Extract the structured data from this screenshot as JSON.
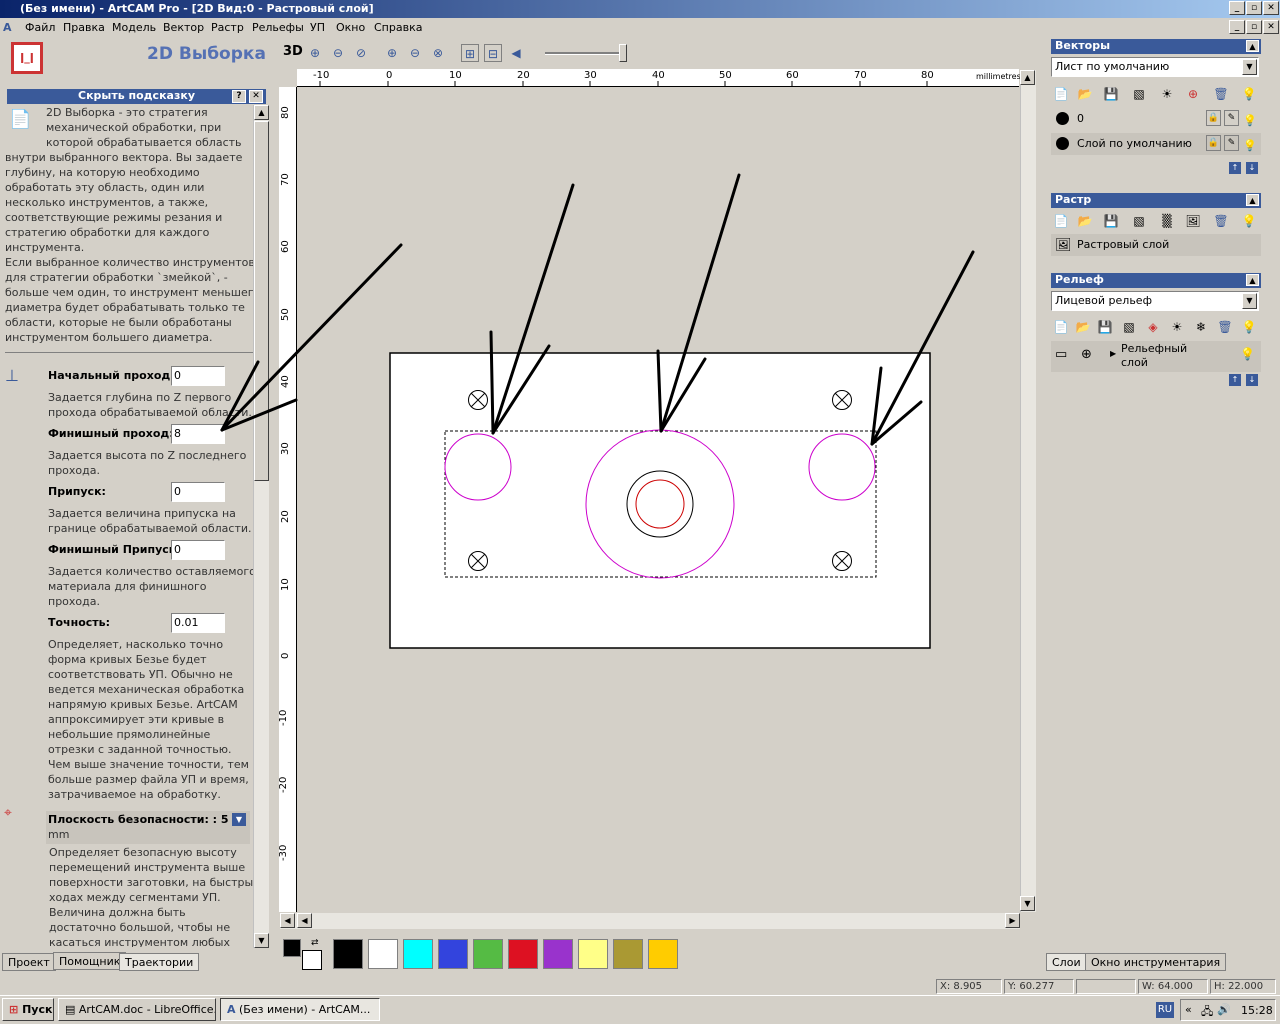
{
  "window": {
    "title": "(Без имени) - ArtCAM Pro - [2D Вид:0 - Растровый слой]"
  },
  "menu": [
    "Файл",
    "Правка",
    "Модель",
    "Вектор",
    "Растр",
    "Рельефы",
    "УП",
    "Окно",
    "Справка"
  ],
  "left": {
    "title": "2D Выборка",
    "hint_bar": "Скрыть подсказку",
    "description": [
      "2D Выборка - это стратегия",
      "механической обработки, при",
      "которой обрабатывается область",
      "внутри выбранного вектора. Вы задаете",
      "глубину, на которую необходимо",
      "обработать эту область, один или",
      "несколько инструментов, а также,",
      "соответствующие режимы резания и",
      "стратегию обработки для каждого",
      "инструмента.",
      "Если выбранное количество инструментов",
      "для стратегии обработки `змейкой`, -",
      "больше чем один, то инструмент меньшего",
      "диаметра будет обрабатывать только те",
      "области, которые не были обработаны",
      "инструментом большего диаметра."
    ],
    "fields": [
      {
        "label": "Начальный проход:",
        "value": "0",
        "help": [
          "Задается глубина по Z первого",
          "прохода обрабатываемой области."
        ]
      },
      {
        "label": "Финишный проход:",
        "value": "8",
        "help": [
          "Задается высота по Z последнего",
          "прохода."
        ]
      },
      {
        "label": "Припуск:",
        "value": "0",
        "help": [
          "Задается величина припуска на",
          "границе обрабатываемой области."
        ]
      },
      {
        "label": "Финишный Припуск:",
        "value": "0",
        "help": [
          "Задается количество оставляемого",
          "материала для финишного",
          "прохода."
        ]
      },
      {
        "label": "Точность:",
        "value": "0.01",
        "help": [
          "Определяет, насколько точно",
          "форма кривых Безье будет",
          "соответствовать УП. Обычно не",
          "ведется механическая обработка",
          "напрямую кривых Безье. ArtCAM",
          "аппроксимирует эти кривые в",
          "небольшие прямолинейные",
          "отрезки с заданной точностью.",
          "Чем выше значение точности, тем",
          "больше размер файла УП и время,",
          "затрачиваемое на обработку."
        ]
      }
    ],
    "safety": {
      "label": "Плоскость безопасности: : 5",
      "unit": "mm",
      "help": [
        "Определяет безопасную высоту",
        "перемещений инструмента выше",
        "поверхности заготовки, на быстрых",
        "ходах между сегментами УП.",
        "Величина должна быть",
        "достаточно большой, чтобы не",
        "касаться инструментом любых"
      ]
    },
    "tabs": [
      "Проект",
      "Помощник",
      "Траектории"
    ]
  },
  "toolbar2d": {
    "mode_3d": "3D"
  },
  "ruler": {
    "h_ticks": [
      "-10",
      "0",
      "10",
      "20",
      "30",
      "40",
      "50",
      "60",
      "70",
      "80"
    ],
    "h_unit": "millimetres",
    "v_ticks": [
      "80",
      "70",
      "60",
      "50",
      "40",
      "30",
      "20",
      "10",
      "0",
      "-10",
      "-20",
      "-30"
    ]
  },
  "palette": [
    "#000000",
    "#ffffff",
    "#00ffff",
    "#3344dd",
    "#55bb44",
    "#dd1122",
    "#9933cc",
    "#ffff88",
    "#aa9933",
    "#ffcc00"
  ],
  "right": {
    "vectors": {
      "title": "Векторы",
      "sheet": "Лист по умолчанию",
      "layers": [
        "0",
        "Слой по умолчанию"
      ]
    },
    "raster": {
      "title": "Растр",
      "layer": "Растровый слой"
    },
    "relief": {
      "title": "Рельеф",
      "sheet": "Лицевой рельеф",
      "layer": "Рельефный слой"
    },
    "tabs": [
      "Слои",
      "Окно инструментария"
    ]
  },
  "status": {
    "x": "X: 8.905",
    "y": "Y: 60.277",
    "w": "W: 64.000",
    "h": "H: 22.000"
  },
  "taskbar": {
    "start": "Пуск",
    "items": [
      "ArtCAM.doc - LibreOffice...",
      "(Без имени) - ArtCAM..."
    ],
    "lang": "RU",
    "time": "15:28"
  }
}
